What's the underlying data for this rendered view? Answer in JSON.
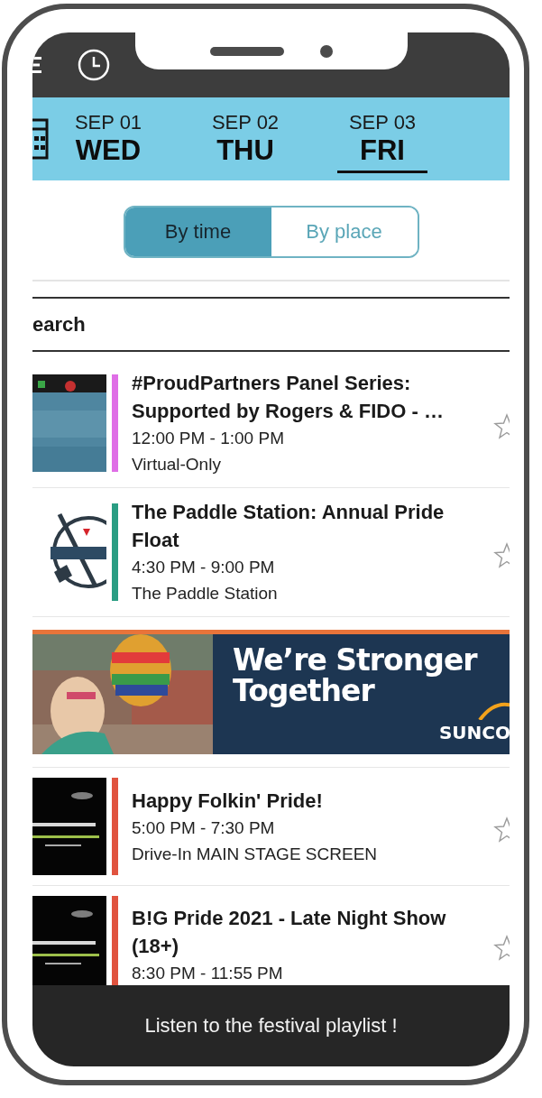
{
  "date_tabs": [
    {
      "date": "SEP 01",
      "weekday": "WED",
      "selected": false
    },
    {
      "date": "SEP 02",
      "weekday": "THU",
      "selected": false
    },
    {
      "date": "SEP 03",
      "weekday": "FRI",
      "selected": true
    }
  ],
  "view_toggle": [
    {
      "label": "By time",
      "selected": true
    },
    {
      "label": "By place",
      "selected": false
    }
  ],
  "search": {
    "placeholder": "earch"
  },
  "feed": [
    {
      "kind": "event",
      "color": "#df6ee6",
      "title": "#ProudPartners Panel Series: Supported by Rogers & FIDO - …",
      "time": "12:00 PM - 1:00 PM",
      "place": "Virtual-Only",
      "starred": false
    },
    {
      "kind": "event",
      "color": "#2a9d83",
      "title": "The Paddle Station: Annual Pride Float",
      "time": "4:30 PM - 9:00 PM",
      "place": "The Paddle Station",
      "starred": false
    },
    {
      "kind": "banner",
      "headline": "We’re Stronger Together",
      "brand": "SUNCO"
    },
    {
      "kind": "event",
      "color": "#e0533f",
      "title": "Happy Folkin' Pride!",
      "time": "5:00 PM - 7:30 PM",
      "place": "Drive-In MAIN STAGE SCREEN",
      "starred": false
    },
    {
      "kind": "event",
      "color": "#e0533f",
      "title": "B!G Pride 2021 - Late Night Show (18+)",
      "time": "8:30 PM - 11:55 PM",
      "starred": false
    }
  ],
  "bottom_bar": {
    "label": "Listen to the festival playlist !"
  }
}
